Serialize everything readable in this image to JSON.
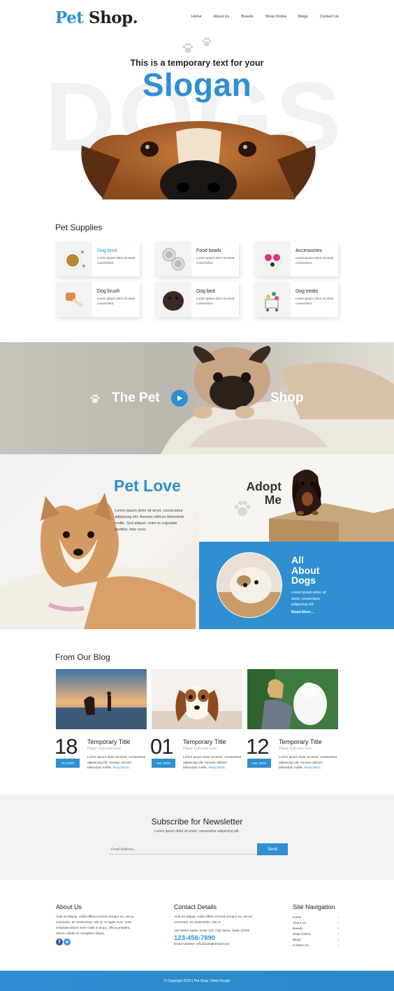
{
  "header": {
    "logo_pet": "Pet",
    "logo_shop": "Shop.",
    "nav": [
      "Home",
      "About Us",
      "Breeds",
      "Shop Online",
      "Blogs",
      "Contact Us"
    ]
  },
  "hero": {
    "subtitle": "This is a temporary text for your",
    "title": "Slogan",
    "bg_text": "DOGS"
  },
  "supplies": {
    "title": "Pet Supplies",
    "items": [
      {
        "title": "Dog food",
        "desc": "Lorem ipsum dolor sit amet consectetur."
      },
      {
        "title": "Food bowls",
        "desc": "Lorem ipsum dolor sit amet consectetur."
      },
      {
        "title": "Accessories",
        "desc": "Lorem ipsum dolor sit amet consectetur."
      },
      {
        "title": "Dog brush",
        "desc": "Lorem ipsum dolor sit amet consectetur."
      },
      {
        "title": "Dog bed",
        "desc": "Lorem ipsum dolor sit amet consectetur."
      },
      {
        "title": "Dog treats",
        "desc": "Lorem ipsum dolor sit amet consectetur."
      }
    ]
  },
  "banner": {
    "left": "The Pet",
    "right": "Shop"
  },
  "pet_love": {
    "title": "Pet Love",
    "text": "Lorem ipsum dolor sit amet, consectetur adipiscing elit. Aenean ultrices bibendum mollis. Sed aliquet, enim et vulputate porttitor, felis nunc."
  },
  "adopt": {
    "line1": "Adopt",
    "line2": "Me"
  },
  "about_dogs": {
    "line1": "All",
    "line2": "About",
    "line3": "Dogs",
    "text": "Lorem ipsum dolor sit amet, consectetur adipiscing elit.",
    "more": "Read More..."
  },
  "blog": {
    "title": "From Our Blog",
    "posts": [
      {
        "num": "18",
        "date": "Oct 2019",
        "title": "Temporary Title",
        "sub": "Place Sub-text here",
        "desc": "Lorem ipsum dolor sit amet, consectetur adipiscing elit. Aenean ultrices bibendum mollis.",
        "more": "Read More..."
      },
      {
        "num": "01",
        "date": "Dec 2019",
        "title": "Temporary Title",
        "sub": "Place Sub-text here",
        "desc": "Lorem ipsum dolor sit amet, consectetur adipiscing elit. Aenean ultrices bibendum mollis.",
        "more": "Read More..."
      },
      {
        "num": "12",
        "date": "Dec 2019",
        "title": "Temporary Title",
        "sub": "Place Sub-text here",
        "desc": "Lorem ipsum dolor sit amet, consectetur adipiscing elit. Aenean ultrices bibendum mollis.",
        "more": "Read More..."
      }
    ]
  },
  "newsletter": {
    "title": "Subscribe for Newsletter",
    "sub": "Lorem ipsum dolor sit amet, consectetur adipiscing elit.",
    "placeholder": "Email Address...",
    "button": "Send"
  },
  "footer": {
    "about_title": "About Us",
    "about_text": "Aute ea aliquip, mollit officia et lorem tempor ea, est ea commodo. Et consectetur, sint ut. In fugiat irure. Irure voluptate dolore esse mollit in id qui, officia proident, dolore, minim ex excepteur aliqua.",
    "contact_title": "Contact Details",
    "contact_text": "Aute ea aliquip, mollit officia et lorem tempor ea, est ea commodo. Et consectetur, sint ut.",
    "address": "123 Street Name, Suite 123, City Name, State 12345",
    "phone": "123-456-7890",
    "email": "Email Address: info@sampleemail.com",
    "nav_title": "Site Navigation",
    "nav": [
      "Home",
      "About Us",
      "Breeds",
      "Shop Online",
      "Blogs",
      "Contact Us"
    ],
    "copyright": "© Copyright 2019  |  Pet Shop  |  Web Design"
  },
  "colors": {
    "accent": "#2f8fd0"
  }
}
